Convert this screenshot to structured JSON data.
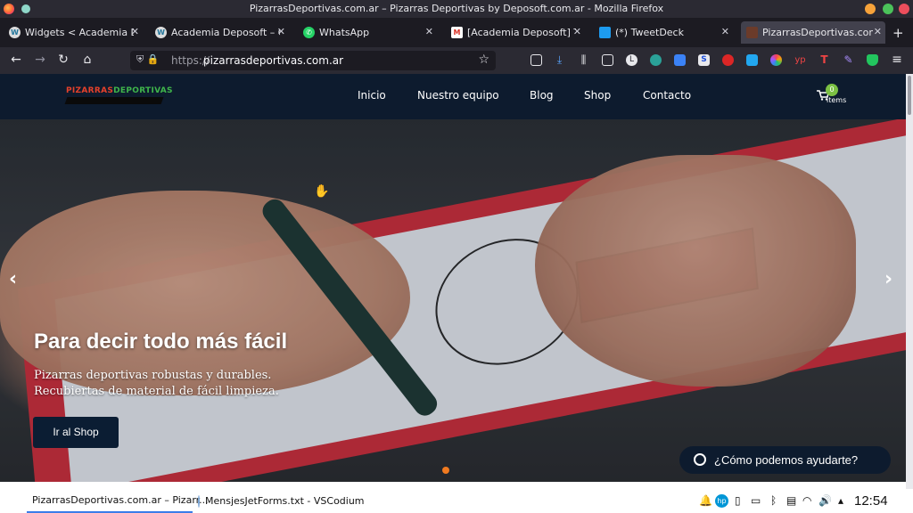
{
  "window": {
    "title": "PizarrasDeportivas.com.ar – Pizarras Deportivas by Deposoft.com.ar - Mozilla Firefox"
  },
  "tabs": [
    {
      "label": "Widgets < Academia Depo",
      "icon": "wordpress-icon",
      "active": false
    },
    {
      "label": "Academia Deposoft – Otro",
      "icon": "wordpress-icon",
      "active": false
    },
    {
      "label": "WhatsApp",
      "icon": "whatsapp-icon",
      "active": false
    },
    {
      "label": "[Academia Deposoft] Tu si",
      "icon": "gmail-icon",
      "active": false
    },
    {
      "label": "(*) TweetDeck",
      "icon": "twitter-icon",
      "active": false
    },
    {
      "label": "PizarrasDeportivas.com.ar",
      "icon": "site-icon",
      "active": true
    }
  ],
  "urlbar": {
    "protocol": "https://",
    "host": "pizarrasdeportivas.com.ar"
  },
  "site": {
    "logo_part1": "PIZARRAS",
    "logo_part2": "DEPORTIVAS",
    "menu": [
      "Inicio",
      "Nuestro equipo",
      "Blog",
      "Shop",
      "Contacto"
    ],
    "cart_count": "0",
    "cart_label": "items"
  },
  "hero": {
    "title": "Para decir todo más fácil",
    "subtitle_line1": "Pizarras deportivas robustas y durables.",
    "subtitle_line2": "Recubiertas de material de fácil limpieza.",
    "button": "Ir al Shop",
    "prev_arrow": "‹",
    "next_arrow": "›"
  },
  "whatsapp_pill": {
    "text": "¿Cómo podemos ayudarte?"
  },
  "taskbar": {
    "tasks": [
      {
        "label": "PizarrasDeportivas.com.ar – Pizarr...",
        "active": true
      },
      {
        "label": "MensjesJetForms.txt - VSCodium",
        "active": false
      }
    ],
    "clock": "12:54"
  },
  "colors": {
    "site_header_bg": "#0d1b2e",
    "accent_orange": "#f07a20",
    "cart_badge": "#7bc043",
    "logo_red": "#e5412b",
    "logo_green": "#3fb54b"
  }
}
